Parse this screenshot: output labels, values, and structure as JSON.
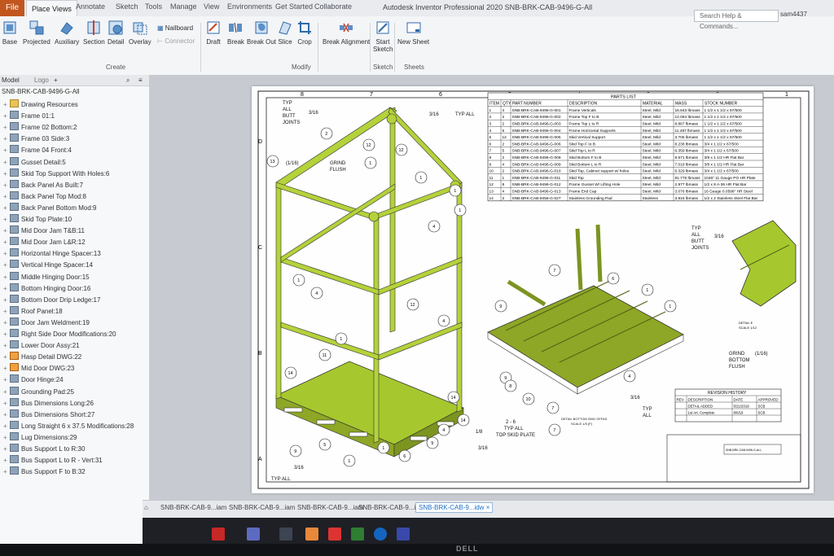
{
  "ribbon": {
    "file_tab": "File",
    "tabs": [
      "Place Views",
      "Annotate",
      "Sketch",
      "Tools",
      "Manage",
      "View",
      "Environments",
      "Get Started",
      "Collaborate"
    ],
    "title": "Autodesk Inventor Professional 2020   SNB-BRK-CAB-9496-G-All",
    "search_placeholder": "Search Help & Commands...",
    "user": "sam4437",
    "buttons": [
      "Base",
      "Projected",
      "Auxiliary",
      "Section",
      "Detail",
      "Overlay",
      "Nailboard",
      "Connector",
      "Draft",
      "Break",
      "Break Out",
      "Slice",
      "Crop",
      "Break Alignment",
      "Start Sketch",
      "New Sheet"
    ],
    "groups": [
      "Create",
      "Modify",
      "Sketch",
      "Sheets"
    ]
  },
  "browser": {
    "tabs": [
      "Model",
      "Logo"
    ],
    "root": "SNB-BRK-CAB-9496-G-All",
    "items": [
      "Drawing Resources",
      "Frame 01:1",
      "Frame 02 Bottom:2",
      "Frame 03 Side:3",
      "Frame 04 Front:4",
      "Gusset Detail:5",
      "Skid Top Support With Holes:6",
      "Back Panel As Built:7",
      "Back Panel Top Mod:8",
      "Back Panel Bottom Mod:9",
      "Skid Top Plate:10",
      "Mid Door Jam T&B:11",
      "Mid Door Jam L&R:12",
      "Horizontal Hinge Spacer:13",
      "Vertical Hinge Spacer:14",
      "Middle Hinging Door:15",
      "Bottom Hinging Door:16",
      "Bottom Door Drip Ledge:17",
      "Roof Panel:18",
      "Door Jam Weldment:19",
      "Right Side Door Modifications:20",
      "Lower Door Assy:21",
      "Hasp Detail DWG:22",
      "Mid Door DWG:23",
      "Door Hinge:24",
      "Grounding Pad:25",
      "Bus Dimensions Long:26",
      "Bus Dimensions Short:27",
      "Long Straight 6 x 37.5 Modifications:28",
      "Lug Dimensions:29",
      "Bus Support L to R:30",
      "Bus Support L to R - Vert:31",
      "Bus Support F to B:32"
    ]
  },
  "drawing": {
    "parts_list_title": "PARTS LIST",
    "headers": [
      "ITEM",
      "QTY",
      "PART NUMBER",
      "DESCRIPTION",
      "MATERIAL",
      "MASS",
      "STOCK NUMBER"
    ],
    "rows": [
      [
        "1",
        "4",
        "SNB-BRK-CAB-9496-G-001",
        "Frame Verticals",
        "Steel, Mild",
        "16.843 lbmass",
        "1 1/2 x 1 1/2 x 67/500"
      ],
      [
        "2",
        "2",
        "SNB-BRK-CAB-9496-G-002",
        "Frame Top F to B",
        "Steel, Mild",
        "12.064 lbmass",
        "1 1/2 x 1 1/2 x 67/500"
      ],
      [
        "3",
        "2",
        "SNB-BRK-CAB-9496-G-003",
        "Frame Top L to R",
        "Steel, Mild",
        "8.867 lbmass",
        "1 1/2 x 1 1/2 x 67/500"
      ],
      [
        "4",
        "5",
        "SNB-BRK-CAB-9496-G-004",
        "Frame Horizontal Supports",
        "Steel, Mild",
        "11.487 lbmass",
        "1 1/2 x 1 1/2 x 67/500"
      ],
      [
        "5",
        "12",
        "SNB-BRK-CAB-9496-G-005",
        "Skid Vertical Support",
        "Steel, Mild",
        "3.705 lbmass",
        "1 1/2 x 1 1/2 x 67/500"
      ],
      [
        "6",
        "2",
        "SNB-BRK-CAB-9496-G-006",
        "Skid Top F to B",
        "Steel, Mild",
        "8.238 lbmass",
        "3/4 x 1 1/2 x 67/500"
      ],
      [
        "7",
        "5",
        "SNB-BRK-CAB-9496-G-007",
        "Skid Top L to R",
        "Steel, Mild",
        "6.359 lbmass",
        "3/4 x 1 1/2 x 67/500"
      ],
      [
        "8",
        "2",
        "SNB-BRK-CAB-9496-G-008",
        "Skid Bottom F to B",
        "Steel, Mild",
        "9.571 lbmass",
        "3/8 x 1 1/2 HR Flat Bar"
      ],
      [
        "9",
        "4",
        "SNB-BRK-CAB-9496-G-009",
        "Skid Bottom L to R",
        "Steel, Mild",
        "7.019 lbmass",
        "3/8 x 1 1/2 HR Flat Bar"
      ],
      [
        "10",
        "2",
        "SNB-BRK-CAB-9496-G-010",
        "Skid Top, Cabinet support w/ holes",
        "Steel, Mild",
        "6.329 lbmass",
        "3/4 x 1 1/2 x 67/500"
      ],
      [
        "11",
        "1",
        "SNB-BRK-CAB-9496-G-011",
        "Skid Top",
        "Steel, Mild",
        "81.776 lbmass",
        "1046\" 11 Gauge PO HR Plate"
      ],
      [
        "12",
        "8",
        "SNB-BRK-CAB-9496-G-012",
        "Frame Gusset W/ Lifting Hole",
        "Steel, Mild",
        "2.977 lbmass",
        "1/2 x 8 A-36 HR Flat Bar"
      ],
      [
        "13",
        "4",
        "SNB-BRK-CAB-9496-G-013",
        "Frame End Cap",
        "Steel, Mild",
        "3.076 lbmass",
        "16 Gauge 0.0598\" HR Steel"
      ],
      [
        "14",
        "2",
        "SNB-BRK-CAB-9456-G-027",
        "Stainless Grounding Pad",
        "Stainless",
        "3.816 lbmass",
        "1/2 x 2 Stainless Steel Flat Bar"
      ]
    ],
    "notes": {
      "typ_all_butt_joints": [
        "TYP",
        "ALL",
        "BUTT",
        "JOINTS"
      ],
      "grind_flush": [
        "GRIND",
        "FLUSH"
      ],
      "grind_bottom_flush": [
        "GRIND",
        "BOTTOM",
        "FLUSH"
      ],
      "weld_316": "3/16",
      "weld_116": "(1/16)",
      "weld_18": "1/8",
      "spacing": "2 - 6",
      "typ_all": "TYP ALL",
      "top_skid_plate": "TOP SKID PLATE",
      "typ_all_stack": [
        "TYP",
        "ALL"
      ],
      "detail_note": [
        "DETAIL BOTTOM SKID OFFAS",
        "SCALE 1/5 (F)"
      ],
      "detail_view": [
        "DETAIL E",
        "SCALE 1/12"
      ]
    },
    "revision": {
      "title": "REVISION HISTORY",
      "headers": [
        "REV",
        "DESCRIPTION",
        "DATE",
        "APPROVED"
      ],
      "rows": [
        [
          "",
          "DETAIL ADDED",
          "5/21/2019",
          "SCB"
        ],
        [
          "",
          "1st Art. Complete",
          "8/6/19",
          "SCB"
        ]
      ]
    },
    "title_block": "SNB-BRK-CAB-9496-G-ALL",
    "balloons": [
      "1",
      "2",
      "3",
      "4",
      "5",
      "6",
      "7",
      "8",
      "9",
      "10",
      "11",
      "12",
      "13",
      "14"
    ],
    "border_letters": [
      "A",
      "B",
      "C",
      "D"
    ],
    "border_numbers": [
      "8",
      "7",
      "6",
      "5",
      "4",
      "3",
      "2",
      "1"
    ]
  },
  "doc_tabs": [
    "SNB-BRK-CAB-9...iam",
    "SNB-BRK-CAB-9...iam",
    "SNB-BRK-CAB-9...iam",
    "SNB-BRK-CAB-9...ipt",
    "SNB-BRK-CAB-9...idw"
  ],
  "monitor_brand": "DELL",
  "colors": {
    "accent": "#c2561f",
    "part_green": "#a8c830",
    "active_tab": "#1a6ec8"
  }
}
